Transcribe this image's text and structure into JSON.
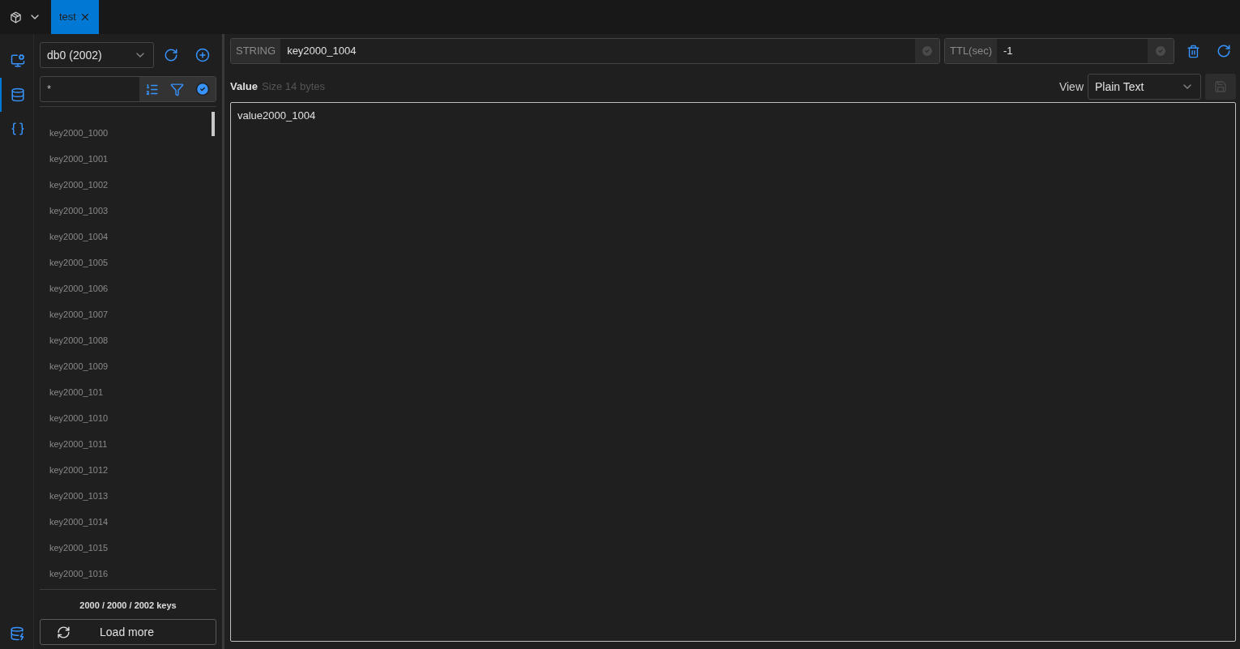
{
  "tabs": [
    {
      "label": "test",
      "selected": true
    }
  ],
  "rail": [
    {
      "kind": "server",
      "selected": false
    },
    {
      "kind": "database",
      "selected": true
    },
    {
      "kind": "braces",
      "selected": false
    }
  ],
  "sidebar": {
    "db_select": "db0 (2002)",
    "search_value": "*",
    "keys": [
      "key2000_1000",
      "key2000_1001",
      "key2000_1002",
      "key2000_1003",
      "key2000_1004",
      "key2000_1005",
      "key2000_1006",
      "key2000_1007",
      "key2000_1008",
      "key2000_1009",
      "key2000_101",
      "key2000_1010",
      "key2000_1011",
      "key2000_1012",
      "key2000_1013",
      "key2000_1014",
      "key2000_1015",
      "key2000_1016"
    ],
    "count": "2000 / 2000 / 2002 keys",
    "load_more": "Load more"
  },
  "editor": {
    "type": "STRING",
    "key": "key2000_1004",
    "ttl_label": "TTL(sec)",
    "ttl": "-1",
    "value_label": "Value",
    "size": "Size 14 bytes",
    "view_label": "View",
    "view": "Plain Text",
    "value": "value2000_1004"
  }
}
